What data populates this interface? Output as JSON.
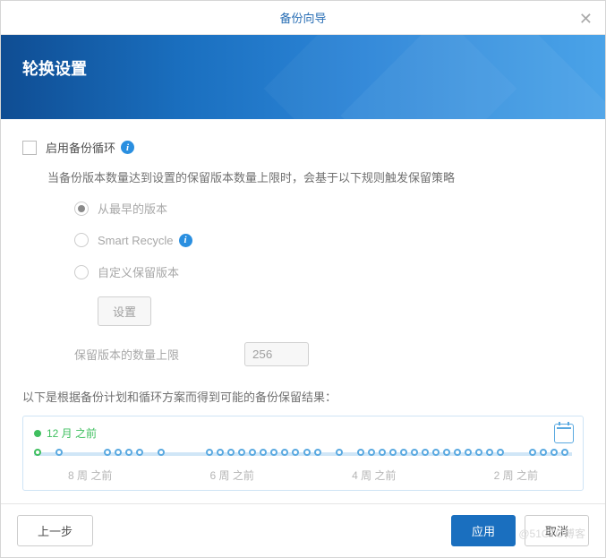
{
  "titlebar": {
    "title": "备份向导"
  },
  "header": {
    "title": "轮换设置"
  },
  "enable": {
    "label": "启用备份循环"
  },
  "instruction": "当备份版本数量达到设置的保留版本数量上限时，会基于以下规则触发保留策略",
  "radios": {
    "earliest": "从最早的版本",
    "smart": "Smart Recycle",
    "custom": "自定义保留版本"
  },
  "settings_btn": "设置",
  "limit": {
    "label": "保留版本的数量上限",
    "value": "256"
  },
  "preview_label": "以下是根据备份计划和循环方案而得到可能的备份保留结果：",
  "timeline": {
    "current": "12 月 之前",
    "labels": [
      "8 周 之前",
      "6 周 之前",
      "4 周 之前",
      "2 周 之前"
    ]
  },
  "footer": {
    "prev": "上一步",
    "apply": "应用",
    "cancel": "取消"
  },
  "watermark": "@51CTO博客"
}
